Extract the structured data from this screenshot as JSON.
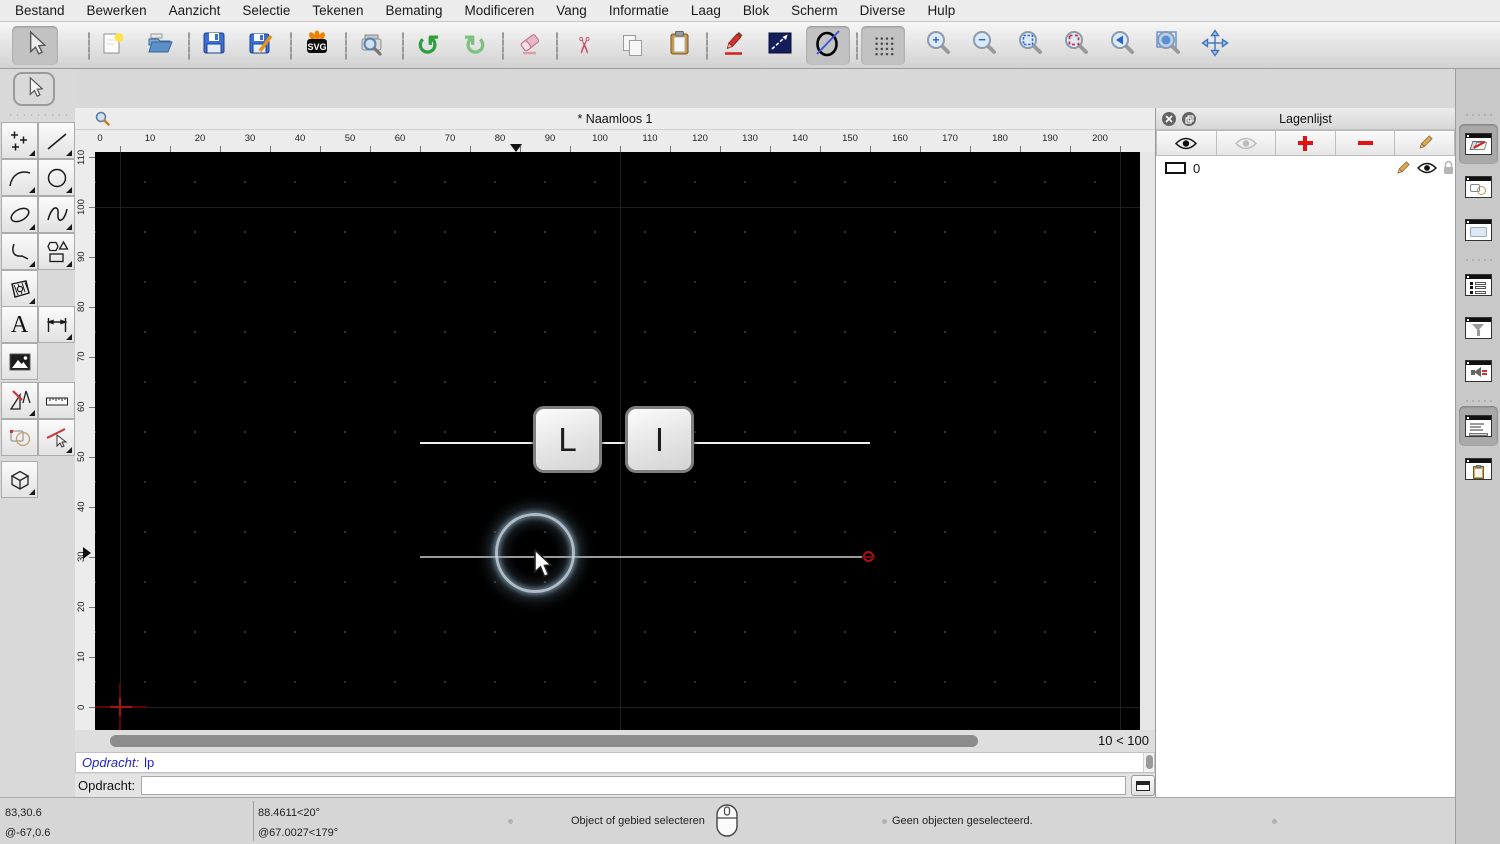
{
  "colors": {
    "accent_command_blue": "#2121cc",
    "canvas_bg": "#000000",
    "origin_red": "#a81414",
    "danger_red": "#e01212",
    "glow_ring": "#cdddE9"
  },
  "menu": {
    "items": [
      "Bestand",
      "Bewerken",
      "Aanzicht",
      "Selectie",
      "Tekenen",
      "Bemating",
      "Modificeren",
      "Vang",
      "Informatie",
      "Laag",
      "Blok",
      "Scherm",
      "Diverse",
      "Hulp"
    ]
  },
  "toolbar": {
    "svg_label": "SVG",
    "icons": [
      "select-arrow",
      "new-document",
      "open-folder",
      "save-floppy",
      "save-as-floppy-pencil",
      "svg-export",
      "print-preview",
      "undo",
      "redo",
      "eraser",
      "cut-scissors",
      "copy",
      "paste-clipboard",
      "edit-pencil",
      "linestyle-square",
      "ellipse-line-tool",
      "grid-toggle",
      "zoom-in",
      "zoom-out",
      "zoom-extents",
      "zoom-selection",
      "zoom-previous",
      "zoom-window",
      "pan"
    ]
  },
  "palette": {
    "icons": [
      "select-arrow",
      "points",
      "line",
      "arc",
      "circle",
      "ellipse",
      "spline",
      "polyline",
      "polygon-shapes",
      "hatch",
      "text",
      "dimension",
      "image",
      "drafting-tools",
      "measure-ruler",
      "modify-shapes",
      "trim",
      "box-3d"
    ],
    "text_tool_glyph": "A"
  },
  "document": {
    "title": "* Naamloos 1",
    "zoom_level": "10 < 100"
  },
  "rulers": {
    "h": [
      "0",
      "10",
      "20",
      "30",
      "40",
      "50",
      "60",
      "70",
      "80",
      "90",
      "100",
      "110",
      "120",
      "130",
      "140",
      "150",
      "160",
      "170",
      "180",
      "190",
      "200"
    ],
    "v": [
      "0",
      "10",
      "20",
      "30",
      "40",
      "50",
      "60",
      "70",
      "80",
      "90",
      "100",
      "110"
    ]
  },
  "canvas": {
    "keycaps": [
      "L",
      "I"
    ]
  },
  "panels": {
    "layers": {
      "title": "Lagenlijst",
      "layer_name": "0"
    }
  },
  "command": {
    "history_prompt": "Opdracht:",
    "history_command": "lp",
    "prompt": "Opdracht:"
  },
  "status": {
    "coord_abs": "83,30.6",
    "coord_rel": "@-67,0.6",
    "polar_abs": "88.4611<20°",
    "polar_rel": "@67.0027<179°",
    "hint": "Object of gebied selecteren",
    "selection": "Geen objecten geselecteerd."
  }
}
